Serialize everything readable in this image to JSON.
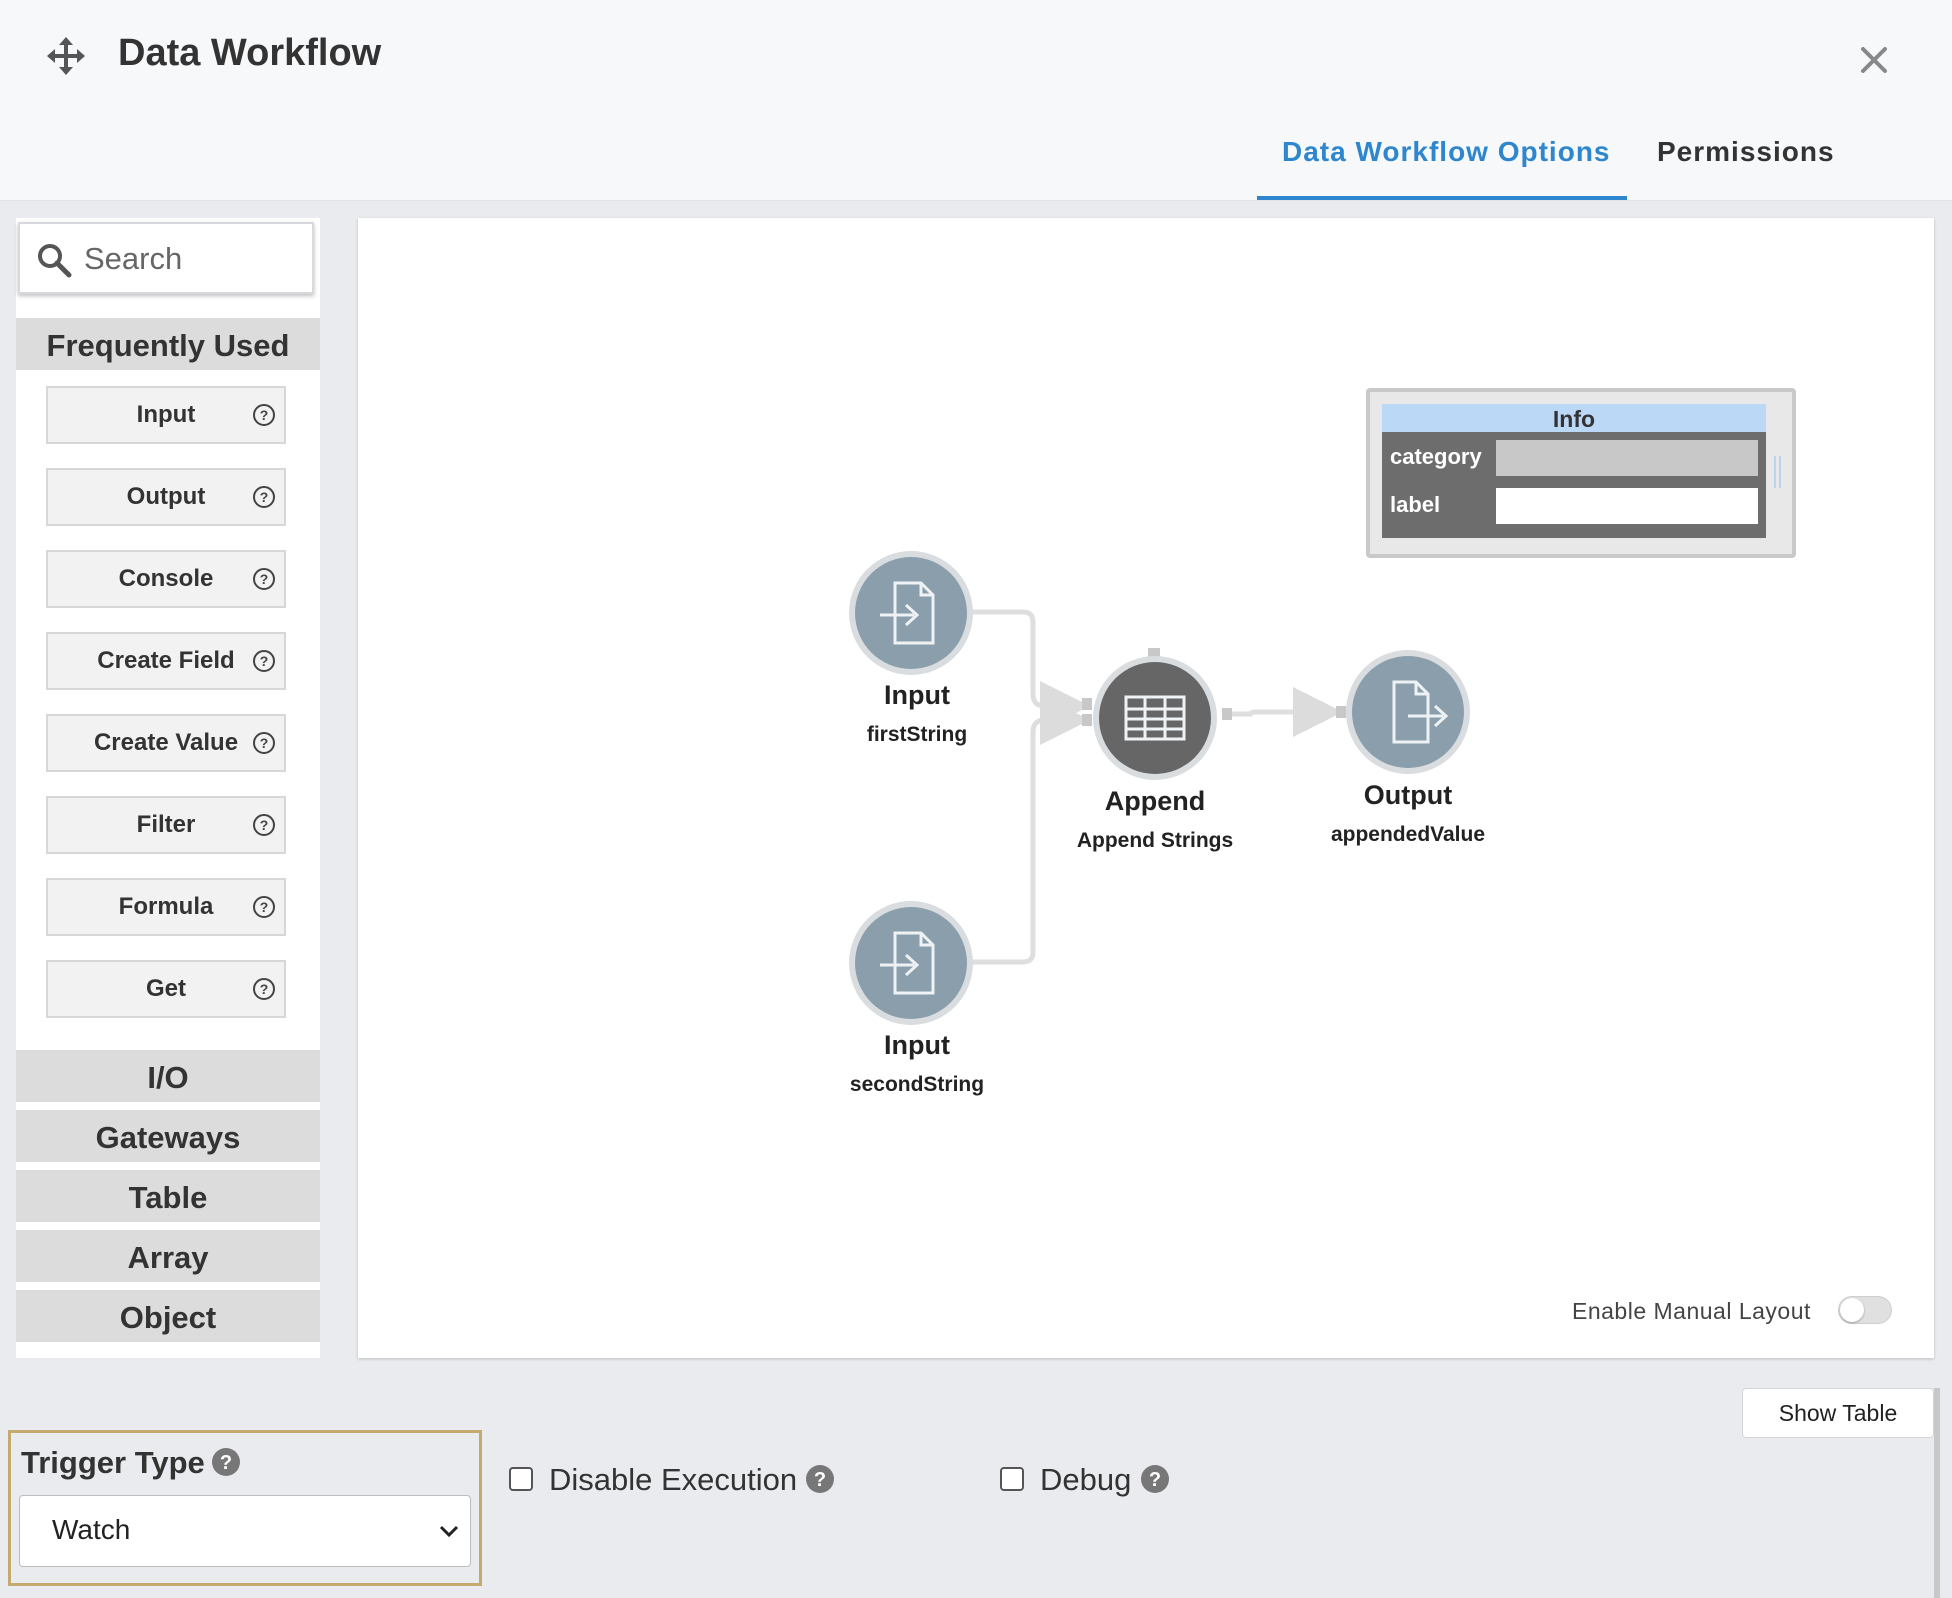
{
  "header": {
    "title": "Data Workflow",
    "tabs": [
      {
        "label": "Data Workflow Options",
        "active": true
      },
      {
        "label": "Permissions",
        "active": false
      }
    ]
  },
  "palette": {
    "search_placeholder": "Search",
    "frequently_used_label": "Frequently Used",
    "items": [
      "Input",
      "Output",
      "Console",
      "Create Field",
      "Create Value",
      "Filter",
      "Formula",
      "Get"
    ],
    "categories": [
      "I/O",
      "Gateways",
      "Table",
      "Array",
      "Object"
    ]
  },
  "diagram": {
    "nodes": [
      {
        "type": "Input",
        "name": "firstString"
      },
      {
        "type": "Input",
        "name": "secondString"
      },
      {
        "type": "Append",
        "name": "Append Strings"
      },
      {
        "type": "Output",
        "name": "appendedValue"
      }
    ],
    "info": {
      "title": "Info",
      "fields": [
        "category",
        "label"
      ]
    },
    "manual_layout_label": "Enable Manual Layout",
    "manual_layout_enabled": false
  },
  "footer": {
    "show_table_label": "Show Table",
    "trigger_type_label": "Trigger Type",
    "trigger_type_value": "Watch",
    "disable_execution_label": "Disable Execution",
    "debug_label": "Debug"
  },
  "colors": {
    "accent": "#2e86cf",
    "node_light": "#8a9eab",
    "node_dark": "#666666",
    "highlight_border": "#c3ab6d"
  }
}
